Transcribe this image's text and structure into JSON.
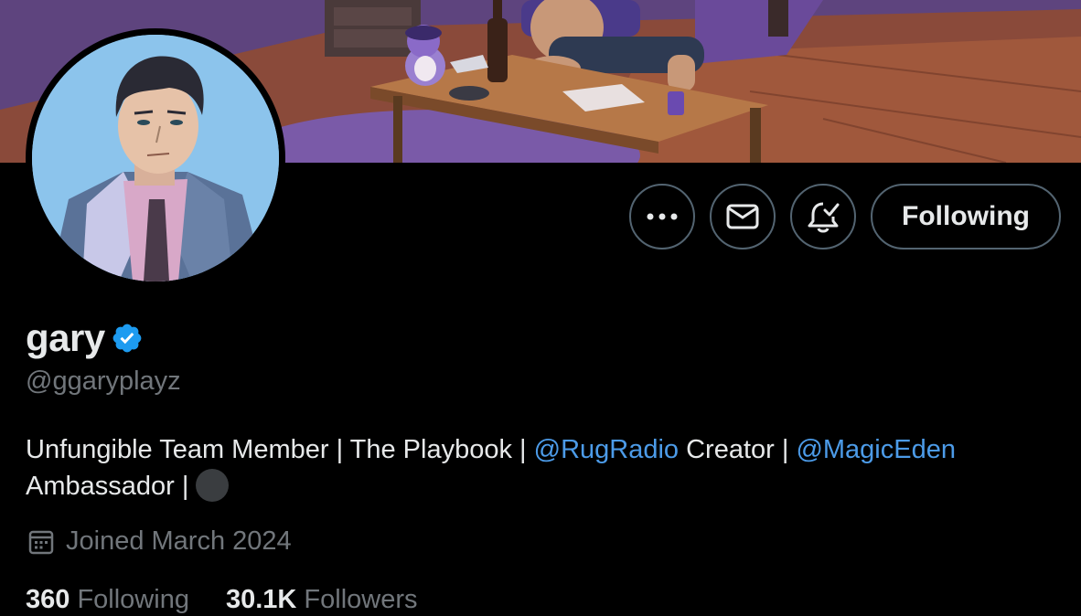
{
  "profile": {
    "display_name": "gary",
    "handle": "@ggaryplayz",
    "verified_icon": "verified-badge-icon",
    "bio": {
      "part1": "Unfungible Team Member | The Playbook | ",
      "mention1": "@RugRadio",
      "part2": " Creator | ",
      "mention2": "@MagicEden",
      "part3": "Ambassador | "
    },
    "joined": "Joined March 2024",
    "following_count": "360",
    "following_label": "Following",
    "followers_count": "30.1K",
    "followers_label": "Followers"
  },
  "actions": {
    "more_icon": "more-dots-icon",
    "message_icon": "envelope-icon",
    "notify_icon": "bell-check-icon",
    "follow_label": "Following"
  },
  "colors": {
    "background": "#000000",
    "text": "#e7e9ea",
    "muted": "#71767b",
    "accent": "#4c9be8",
    "verified": "#1d9bf0",
    "border": "#536471"
  }
}
